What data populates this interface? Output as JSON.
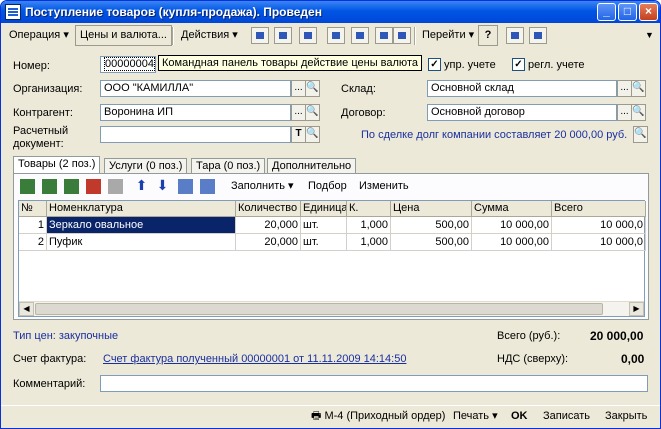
{
  "window": {
    "title": "Поступление товаров (купля-продажа). Проведен",
    "controls": {
      "minimize": "_",
      "maximize": "□",
      "close": "×"
    }
  },
  "toolbar": {
    "operation": "Операция ▾",
    "prices": "Цены и валюта...",
    "actions": "Действия ▾",
    "goto": "Перейти ▾",
    "help": "?"
  },
  "header": {
    "number_label": "Номер:",
    "number_value": "00000004",
    "tooltip": "Командная панель товары действие цены валюта",
    "upr_label": "упр. учете",
    "regl_label": "регл. учете",
    "org_label": "Организация:",
    "org_value": "ООО \"КАМИЛЛА\"",
    "warehouse_label": "Склад:",
    "warehouse_value": "Основной склад",
    "contractor_label": "Контрагент:",
    "contractor_value": "Воронина ИП",
    "contract_label": "Договор:",
    "contract_value": "Основной договор",
    "account_label_1": "Расчетный",
    "account_label_2": "документ:",
    "account_value": "",
    "debt_text": "По сделке долг компании составляет 20 000,00 руб."
  },
  "tabs": [
    {
      "label": "Товары (2 поз.)"
    },
    {
      "label": "Услуги (0 поз.)"
    },
    {
      "label": "Тара (0 поз.)"
    },
    {
      "label": "Дополнительно"
    }
  ],
  "panel_toolbar": {
    "fill": "Заполнить ▾",
    "select": "Подбор",
    "edit": "Изменить"
  },
  "table": {
    "headers": [
      "№",
      "Номенклатура",
      "Количество",
      "Единица",
      "К.",
      "Цена",
      "Сумма",
      "Всего"
    ],
    "rows": [
      [
        "1",
        "Зеркало овальное",
        "20,000",
        "шт.",
        "1,000",
        "500,00",
        "10 000,00",
        "10 000,0"
      ],
      [
        "2",
        "Пуфик",
        "20,000",
        "шт.",
        "1,000",
        "500,00",
        "10 000,00",
        "10 000,0"
      ]
    ]
  },
  "footer": {
    "price_type": "Тип цен: закупочные",
    "total_label": "Всего (руб.):",
    "total_value": "20 000,00",
    "invoice_label": "Счет фактура:",
    "invoice_value": "Счет фактура полученный 00000001 от 11.11.2009 14:14:50",
    "vat_label": "НДС (сверху):",
    "vat_value": "0,00",
    "comment_label": "Комментарий:",
    "comment_value": ""
  },
  "bottom": {
    "m4": "М-4 (Приходный ордер)",
    "print": "Печать ▾",
    "ok": "OK",
    "save": "Записать",
    "close": "Закрыть"
  }
}
